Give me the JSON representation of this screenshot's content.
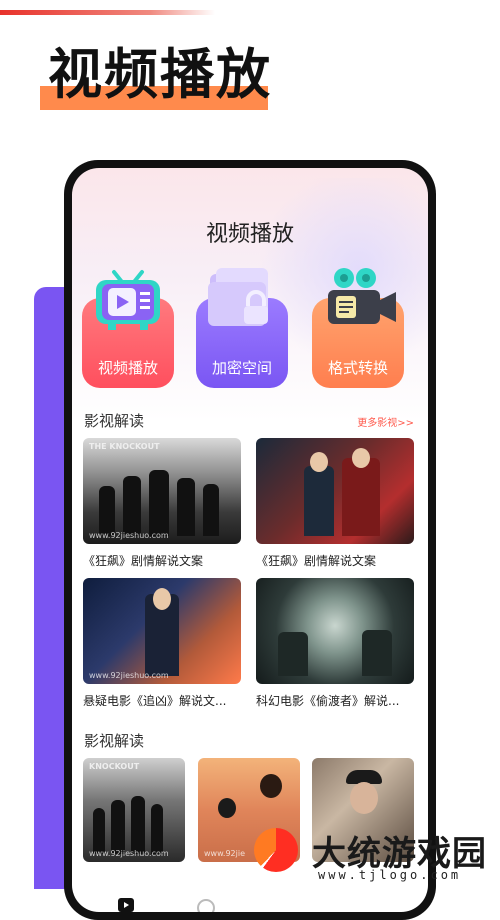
{
  "hero": {
    "title": "视频播放"
  },
  "app": {
    "title": "视频播放"
  },
  "features": [
    {
      "label": "视频播放",
      "icon": "tv-play-icon"
    },
    {
      "label": "加密空间",
      "icon": "folder-lock-icon"
    },
    {
      "label": "格式转换",
      "icon": "camera-convert-icon"
    }
  ],
  "section1": {
    "title": "影视解读",
    "more": "更多影视>>",
    "cards": [
      {
        "title": "《狂飙》剧情解说文案",
        "poster_tag": "THE KNOCKOUT",
        "watermark": "www.92jieshuo.com"
      },
      {
        "title": "《狂飙》剧情解说文案",
        "watermark": ""
      },
      {
        "title": "悬疑电影《追凶》解说文...",
        "watermark": "www.92jieshuo.com"
      },
      {
        "title": "科幻电影《偷渡者》解说...",
        "watermark": ""
      }
    ]
  },
  "section2": {
    "title": "影视解读",
    "cards": [
      {
        "poster_tag": "KNOCKOUT",
        "watermark": "www.92jieshuo.com"
      },
      {
        "watermark": "www.92jie"
      },
      {
        "watermark": ""
      }
    ]
  },
  "watermark": {
    "text": "大统游戏园",
    "url": "www.tjlogo.com"
  },
  "colors": {
    "accent": "#7a55f2",
    "highlight": "#ff8a4c",
    "link": "#ff5a4d"
  }
}
